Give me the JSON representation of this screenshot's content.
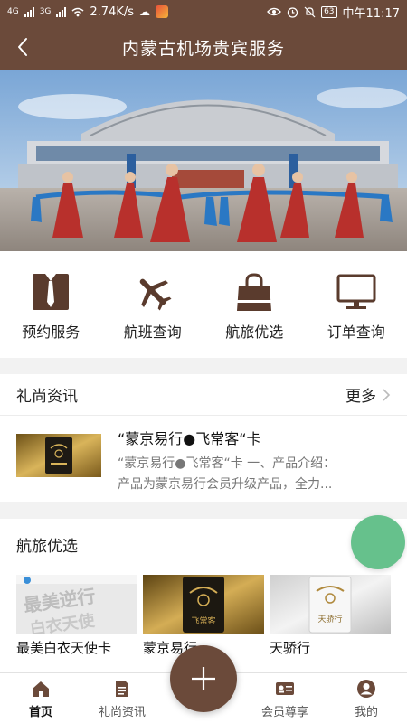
{
  "status_bar": {
    "network": "4G",
    "network2": "3G",
    "speed": "2.74K/s",
    "battery": "63",
    "time": "中午11:17"
  },
  "header": {
    "title": "内蒙古机场贵宾服务",
    "back_icon": "back-chevron-icon"
  },
  "quick_menu": [
    {
      "label": "预约服务",
      "icon": "suit-tie-icon"
    },
    {
      "label": "航班查询",
      "icon": "airplane-icon"
    },
    {
      "label": "航旅优选",
      "icon": "shopping-bag-icon"
    },
    {
      "label": "订单查询",
      "icon": "monitor-icon"
    }
  ],
  "news": {
    "title": "礼尚资讯",
    "more": "更多",
    "item": {
      "title": "“蒙京易行●飞常客“卡",
      "desc_line1": "“蒙京易行●飞常客“卡 一、产品介绍：",
      "desc_line2": "产品为蒙京易行会员升级产品，全力..."
    }
  },
  "travel": {
    "title": "航旅优选",
    "products": [
      {
        "label": "最美白衣天使卡",
        "img_text": "最美逆行 白衣天使"
      },
      {
        "label": "蒙京易行",
        "img_text": "飞常客"
      },
      {
        "label": "天骄行",
        "img_text": "天骄行"
      }
    ]
  },
  "bottom_nav": {
    "items": [
      {
        "label": "首页",
        "icon": "home-icon",
        "active": true
      },
      {
        "label": "礼尚资讯",
        "icon": "document-icon",
        "active": false
      },
      {
        "label": "会员尊享",
        "icon": "member-card-icon",
        "active": false
      },
      {
        "label": "我的",
        "icon": "user-icon",
        "active": false
      }
    ],
    "fab_icon": "plus-icon"
  },
  "colors": {
    "brand": "#6b4a3a",
    "fab_green": "#66c18c"
  }
}
